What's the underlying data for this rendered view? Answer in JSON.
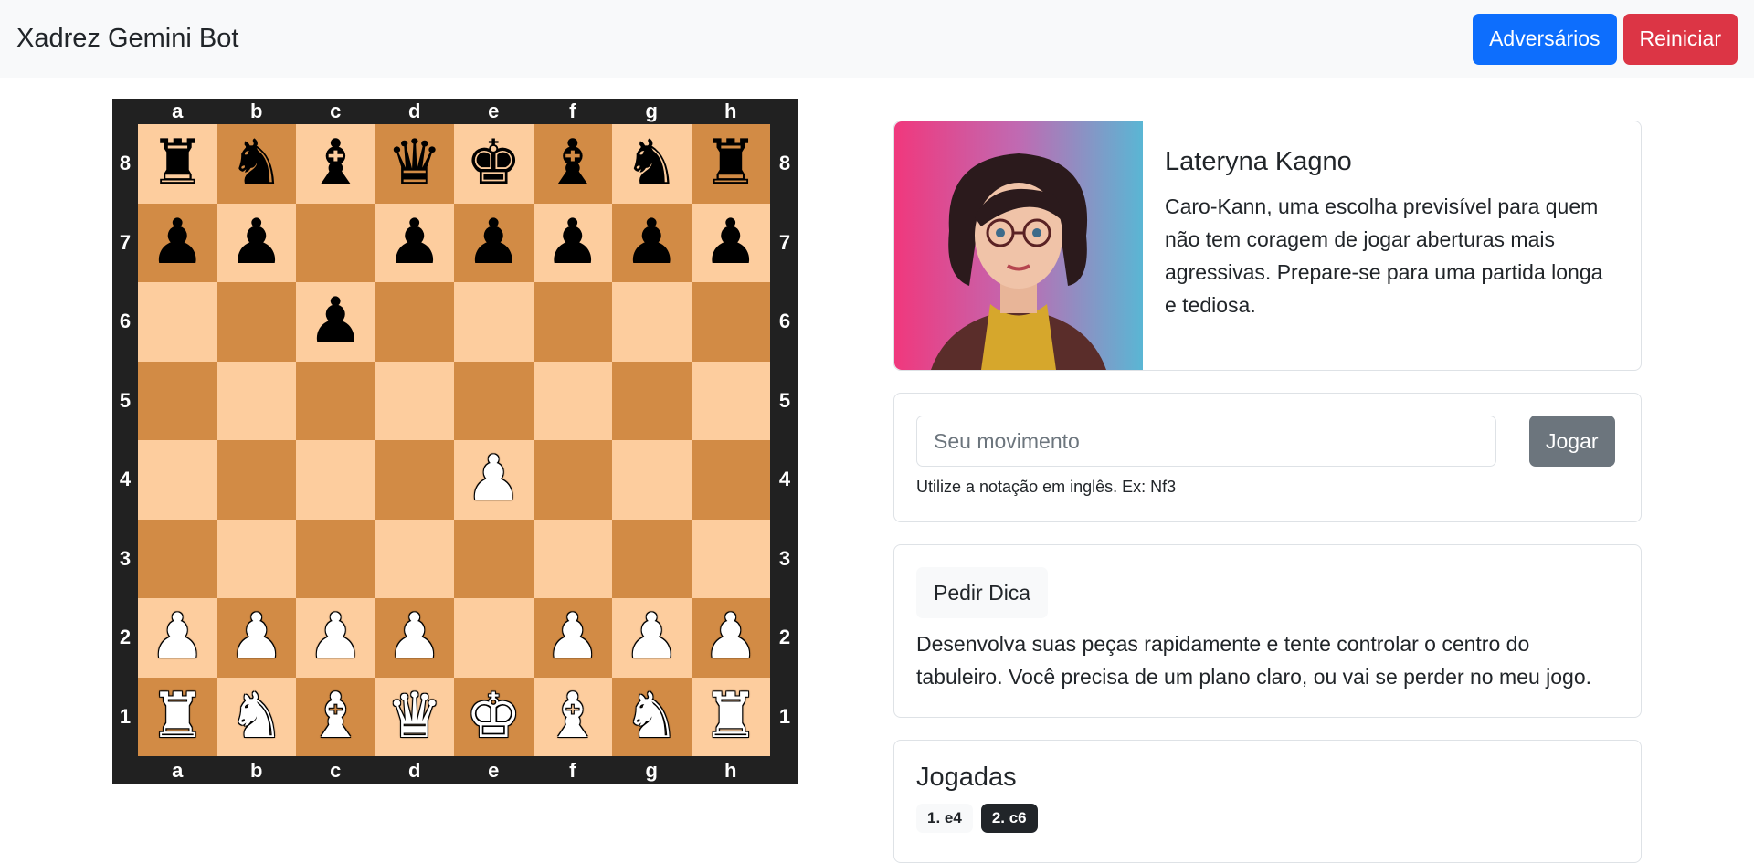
{
  "navbar": {
    "brand": "Xadrez Gemini Bot",
    "opponents_label": "Adversários",
    "restart_label": "Reiniciar"
  },
  "board": {
    "files": [
      "a",
      "b",
      "c",
      "d",
      "e",
      "f",
      "g",
      "h"
    ],
    "ranks": [
      "8",
      "7",
      "6",
      "5",
      "4",
      "3",
      "2",
      "1"
    ],
    "position": [
      [
        "bR",
        "bN",
        "bB",
        "bQ",
        "bK",
        "bB",
        "bN",
        "bR"
      ],
      [
        "bP",
        "bP",
        "",
        "bP",
        "bP",
        "bP",
        "bP",
        "bP"
      ],
      [
        "",
        "",
        "bP",
        "",
        "",
        "",
        "",
        ""
      ],
      [
        "",
        "",
        "",
        "",
        "",
        "",
        "",
        ""
      ],
      [
        "",
        "",
        "",
        "",
        "wP",
        "",
        "",
        ""
      ],
      [
        "",
        "",
        "",
        "",
        "",
        "",
        "",
        ""
      ],
      [
        "wP",
        "wP",
        "wP",
        "wP",
        "",
        "wP",
        "wP",
        "wP"
      ],
      [
        "wR",
        "wN",
        "wB",
        "wQ",
        "wK",
        "wB",
        "wN",
        "wR"
      ]
    ],
    "colors": {
      "light": "#fdcd9e",
      "dark": "#d28b45",
      "frame": "#212121"
    }
  },
  "opponent": {
    "name": "Lateryna Kagno",
    "quote": "Caro-Kann, uma escolha previsível para quem não tem coragem de jogar aberturas mais agressivas. Prepare-se para uma partida longa e tediosa."
  },
  "move_input": {
    "placeholder": "Seu movimento",
    "value": "",
    "play_label": "Jogar",
    "help_text": "Utilize a notação em inglês. Ex: Nf3"
  },
  "tip": {
    "button_label": "Pedir Dica",
    "text": "Desenvolva suas peças rapidamente e tente controlar o centro do tabuleiro. Você precisa de um plano claro, ou vai se perder no meu jogo."
  },
  "history": {
    "title": "Jogadas",
    "moves": [
      {
        "label": "1. e4",
        "style": "light"
      },
      {
        "label": "2. c6",
        "style": "dark"
      }
    ]
  },
  "theme": {
    "primary": "#0d6efd",
    "danger": "#dc3545",
    "secondary": "#6c757d"
  }
}
